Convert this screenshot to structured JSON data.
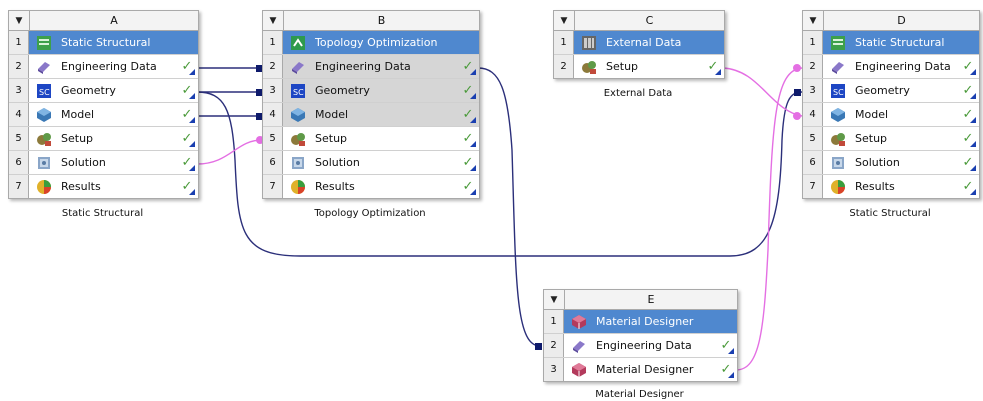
{
  "systems": {
    "A": {
      "letter": "A",
      "caption": "Static Structural",
      "rows": [
        {
          "num": "1",
          "label": "Static Structural",
          "icon": "static-structural-icon",
          "check": "",
          "tri": false
        },
        {
          "num": "2",
          "label": "Engineering Data",
          "icon": "engineering-data-icon",
          "check": "✓",
          "tri": true
        },
        {
          "num": "3",
          "label": "Geometry",
          "icon": "geometry-icon",
          "check": "✓",
          "tri": true
        },
        {
          "num": "4",
          "label": "Model",
          "icon": "model-icon",
          "check": "✓",
          "tri": true
        },
        {
          "num": "5",
          "label": "Setup",
          "icon": "setup-icon",
          "check": "✓",
          "tri": true
        },
        {
          "num": "6",
          "label": "Solution",
          "icon": "solution-icon",
          "check": "✓",
          "tri": true
        },
        {
          "num": "7",
          "label": "Results",
          "icon": "results-icon",
          "check": "✓",
          "tri": true
        }
      ]
    },
    "B": {
      "letter": "B",
      "caption": "Topology Optimization",
      "rows": [
        {
          "num": "1",
          "label": "Topology Optimization",
          "icon": "topology-optimization-icon",
          "check": "",
          "tri": false
        },
        {
          "num": "2",
          "label": "Engineering Data",
          "icon": "engineering-data-icon",
          "check": "✓",
          "tri": true
        },
        {
          "num": "3",
          "label": "Geometry",
          "icon": "geometry-icon",
          "check": "✓",
          "tri": true
        },
        {
          "num": "4",
          "label": "Model",
          "icon": "model-icon",
          "check": "✓",
          "tri": true
        },
        {
          "num": "5",
          "label": "Setup",
          "icon": "setup-icon",
          "check": "✓",
          "tri": true
        },
        {
          "num": "6",
          "label": "Solution",
          "icon": "solution-icon",
          "check": "✓",
          "tri": true
        },
        {
          "num": "7",
          "label": "Results",
          "icon": "results-icon",
          "check": "✓",
          "tri": true
        }
      ]
    },
    "C": {
      "letter": "C",
      "caption": "External Data",
      "rows": [
        {
          "num": "1",
          "label": "External Data",
          "icon": "external-data-icon",
          "check": "",
          "tri": false
        },
        {
          "num": "2",
          "label": "Setup",
          "icon": "setup-icon",
          "check": "✓",
          "tri": true
        }
      ]
    },
    "D": {
      "letter": "D",
      "caption": "Static Structural",
      "rows": [
        {
          "num": "1",
          "label": "Static Structural",
          "icon": "static-structural-icon",
          "check": "",
          "tri": false
        },
        {
          "num": "2",
          "label": "Engineering Data",
          "icon": "engineering-data-icon",
          "check": "✓",
          "tri": true
        },
        {
          "num": "3",
          "label": "Geometry",
          "icon": "geometry-icon",
          "check": "✓",
          "tri": true
        },
        {
          "num": "4",
          "label": "Model",
          "icon": "model-icon",
          "check": "✓",
          "tri": true
        },
        {
          "num": "5",
          "label": "Setup",
          "icon": "setup-icon",
          "check": "✓",
          "tri": true
        },
        {
          "num": "6",
          "label": "Solution",
          "icon": "solution-icon",
          "check": "✓",
          "tri": true
        },
        {
          "num": "7",
          "label": "Results",
          "icon": "results-icon",
          "check": "✓",
          "tri": true
        }
      ]
    },
    "E": {
      "letter": "E",
      "caption": "Material Designer",
      "rows": [
        {
          "num": "1",
          "label": "Material Designer",
          "icon": "material-designer-icon",
          "check": "",
          "tri": false
        },
        {
          "num": "2",
          "label": "Engineering Data",
          "icon": "engineering-data-icon",
          "check": "✓",
          "tri": true
        },
        {
          "num": "3",
          "label": "Material Designer",
          "icon": "material-designer-icon",
          "check": "✓",
          "tri": true
        }
      ]
    }
  },
  "colors": {
    "title_row": "#4f88cf",
    "shared_link": "#0e1a6b",
    "transfer_link": "#e46fe3",
    "check": "#4a9a3a"
  }
}
